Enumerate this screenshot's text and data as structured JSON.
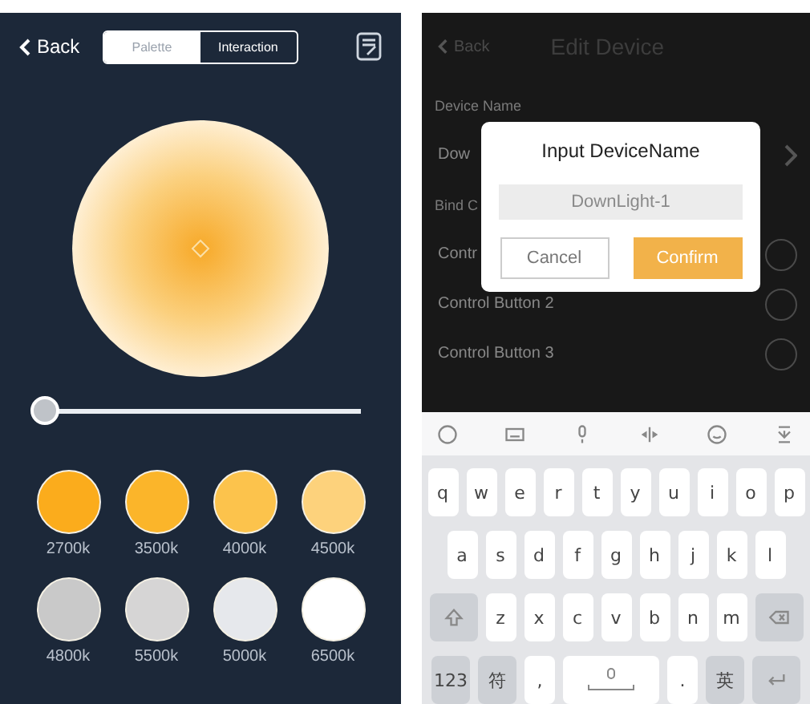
{
  "left": {
    "back": "Back",
    "tabs": [
      {
        "label": "Palette",
        "selected": true
      },
      {
        "label": "Interaction",
        "selected": false
      }
    ],
    "brightness": {
      "level": 0.04
    },
    "swatches": [
      {
        "label": "2700k",
        "color": "#fbac1c"
      },
      {
        "label": "3500k",
        "color": "#fbb52a"
      },
      {
        "label": "4000k",
        "color": "#fcc34c"
      },
      {
        "label": "4500k",
        "color": "#fdd27c"
      },
      {
        "label": "4800k",
        "color": "#c9c9c9"
      },
      {
        "label": "5500k",
        "color": "#d6d5d5"
      },
      {
        "label": "5000k",
        "color": "#e6e8ec"
      },
      {
        "label": "6500k",
        "color": "#ffffff"
      }
    ]
  },
  "right": {
    "back": "Back",
    "title": "Edit Device",
    "rows": [
      {
        "label": "Device Name",
        "kind": "heading"
      },
      {
        "label": "Dow",
        "kind": "value"
      },
      {
        "label": "Bind C",
        "kind": "heading"
      },
      {
        "label": "Contr",
        "kind": "toggle"
      },
      {
        "label": "Control Button 2",
        "kind": "toggle"
      },
      {
        "label": "Control Button 3",
        "kind": "toggle"
      }
    ],
    "dialog": {
      "title": "Input DeviceName",
      "value": "DownLight-1",
      "cancel": "Cancel",
      "confirm": "Confirm"
    },
    "keyboard": {
      "rows": [
        {
          "keys": [
            {
              "kind": "letter",
              "label": "q"
            },
            {
              "kind": "letter",
              "label": "w"
            },
            {
              "kind": "letter",
              "label": "e"
            },
            {
              "kind": "letter",
              "label": "r"
            },
            {
              "kind": "letter",
              "label": "t"
            },
            {
              "kind": "letter",
              "label": "y"
            },
            {
              "kind": "letter",
              "label": "u"
            },
            {
              "kind": "letter",
              "label": "i"
            },
            {
              "kind": "letter",
              "label": "o"
            },
            {
              "kind": "letter",
              "label": "p"
            }
          ]
        },
        {
          "keys": [
            {
              "kind": "letter",
              "label": "a"
            },
            {
              "kind": "letter",
              "label": "s"
            },
            {
              "kind": "letter",
              "label": "d"
            },
            {
              "kind": "letter",
              "label": "f"
            },
            {
              "kind": "letter",
              "label": "g"
            },
            {
              "kind": "letter",
              "label": "h"
            },
            {
              "kind": "letter",
              "label": "j"
            },
            {
              "kind": "letter",
              "label": "k"
            },
            {
              "kind": "letter",
              "label": "l"
            }
          ]
        },
        {
          "keys": [
            {
              "kind": "shift"
            },
            {
              "kind": "letter",
              "label": "z"
            },
            {
              "kind": "letter",
              "label": "x"
            },
            {
              "kind": "letter",
              "label": "c"
            },
            {
              "kind": "letter",
              "label": "v"
            },
            {
              "kind": "letter",
              "label": "b"
            },
            {
              "kind": "letter",
              "label": "n"
            },
            {
              "kind": "letter",
              "label": "m"
            },
            {
              "kind": "backspace"
            }
          ]
        },
        {
          "keys": [
            {
              "kind": "mod",
              "label": "123"
            },
            {
              "kind": "mod",
              "label": "符"
            },
            {
              "kind": "letter",
              "label": ","
            },
            {
              "kind": "space"
            },
            {
              "kind": "letter",
              "label": "."
            },
            {
              "kind": "mod",
              "label": "英"
            },
            {
              "kind": "enter"
            }
          ]
        }
      ]
    }
  }
}
